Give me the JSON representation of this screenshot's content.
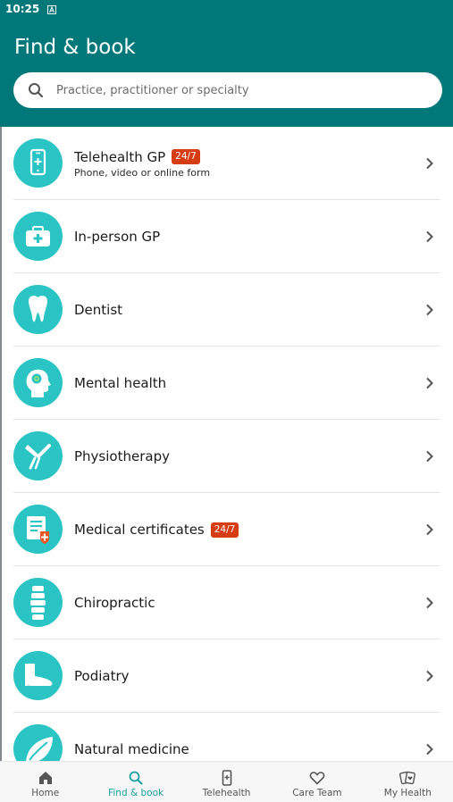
{
  "status_bar": {
    "time": "10:25"
  },
  "header": {
    "title": "Find & book",
    "search_placeholder": "Practice, practitioner or specialty"
  },
  "categories": [
    {
      "label": "Telehealth GP",
      "badge": "24/7",
      "subtitle": "Phone, video or online form",
      "icon": "phone-medical-icon"
    },
    {
      "label": "In-person GP",
      "icon": "medical-bag-icon"
    },
    {
      "label": "Dentist",
      "icon": "tooth-icon"
    },
    {
      "label": "Mental health",
      "icon": "head-mind-icon"
    },
    {
      "label": "Physiotherapy",
      "icon": "knee-joint-icon"
    },
    {
      "label": "Medical certificates",
      "badge": "24/7",
      "icon": "medical-certificate-icon"
    },
    {
      "label": "Chiropractic",
      "icon": "spine-icon"
    },
    {
      "label": "Podiatry",
      "icon": "foot-icon"
    },
    {
      "label": "Natural medicine",
      "icon": "leaf-icon"
    }
  ],
  "bottom_nav": [
    {
      "label": "Home",
      "icon": "home-icon",
      "active": false
    },
    {
      "label": "Find & book",
      "icon": "search-icon",
      "active": true
    },
    {
      "label": "Telehealth",
      "icon": "phone-medical-icon",
      "active": false
    },
    {
      "label": "Care Team",
      "icon": "heart-icon",
      "active": false
    },
    {
      "label": "My Health",
      "icon": "health-cards-icon",
      "active": false
    }
  ],
  "colors": {
    "header_teal": "#00787a",
    "icon_circle": "#2bc4c4",
    "badge_red": "#d63d12",
    "active_nav": "#1a9ea0"
  }
}
